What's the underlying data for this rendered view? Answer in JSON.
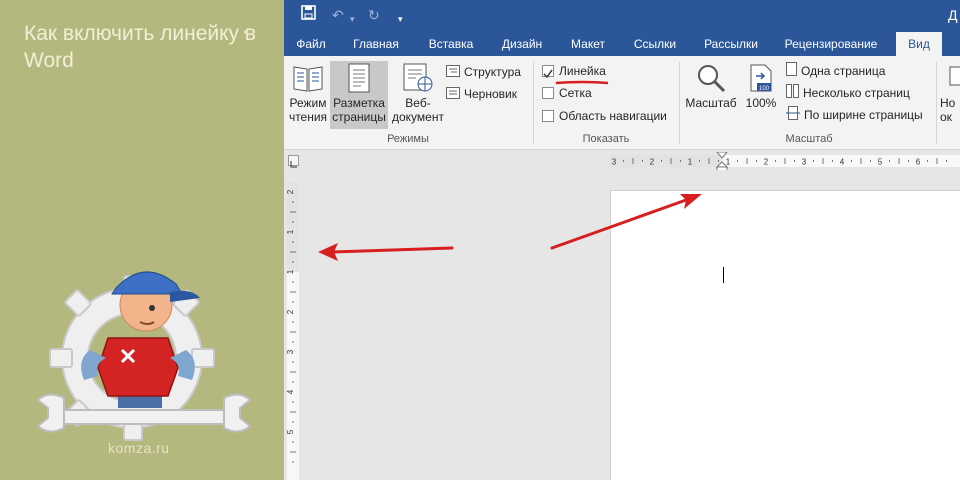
{
  "promo": {
    "title": "Как включить линейку в Word",
    "site": "komza.ru",
    "accent_color": "#b5b87e"
  },
  "window": {
    "title_partial": "Д",
    "qat_icons": [
      "save-icon",
      "undo-icon",
      "redo-icon",
      "customize-qat-icon"
    ],
    "accent_color": "#2b579a"
  },
  "tabs": [
    {
      "label": "Файл",
      "active": false
    },
    {
      "label": "Главная",
      "active": false
    },
    {
      "label": "Вставка",
      "active": false
    },
    {
      "label": "Дизайн",
      "active": false
    },
    {
      "label": "Макет",
      "active": false
    },
    {
      "label": "Ссылки",
      "active": false
    },
    {
      "label": "Рассылки",
      "active": false
    },
    {
      "label": "Рецензирование",
      "active": false
    },
    {
      "label": "Вид",
      "active": true
    }
  ],
  "ribbon": {
    "views": {
      "group_label": "Режимы",
      "read_mode": "Режим чтения",
      "print_layout": "Разметка страницы",
      "web_layout": "Веб-документ",
      "outline": "Структура",
      "draft": "Черновик"
    },
    "show": {
      "group_label": "Показать",
      "ruler": {
        "label": "Линейка",
        "checked": true
      },
      "gridlines": {
        "label": "Сетка",
        "checked": false
      },
      "navigation_pane": {
        "label": "Область навигации",
        "checked": false
      }
    },
    "zoom": {
      "group_label": "Масштаб",
      "zoom": "Масштаб",
      "hundred": "100%",
      "one_page": "Одна страница",
      "multiple_pages": "Несколько страниц",
      "page_width": "По ширине страницы",
      "badge": "100"
    },
    "window": {
      "new_window_partial_1": "Но",
      "new_window_partial_2": "ок"
    }
  },
  "rulers": {
    "horizontal_labels": [
      "3",
      "2",
      "1",
      "1",
      "2",
      "3",
      "4",
      "5",
      "6"
    ],
    "vertical_labels": [
      "2",
      "1",
      "1",
      "2",
      "3",
      "4",
      "5"
    ]
  },
  "annotation": {
    "arrow_color": "#d81f1f",
    "underline_color": "#d81f1f"
  }
}
